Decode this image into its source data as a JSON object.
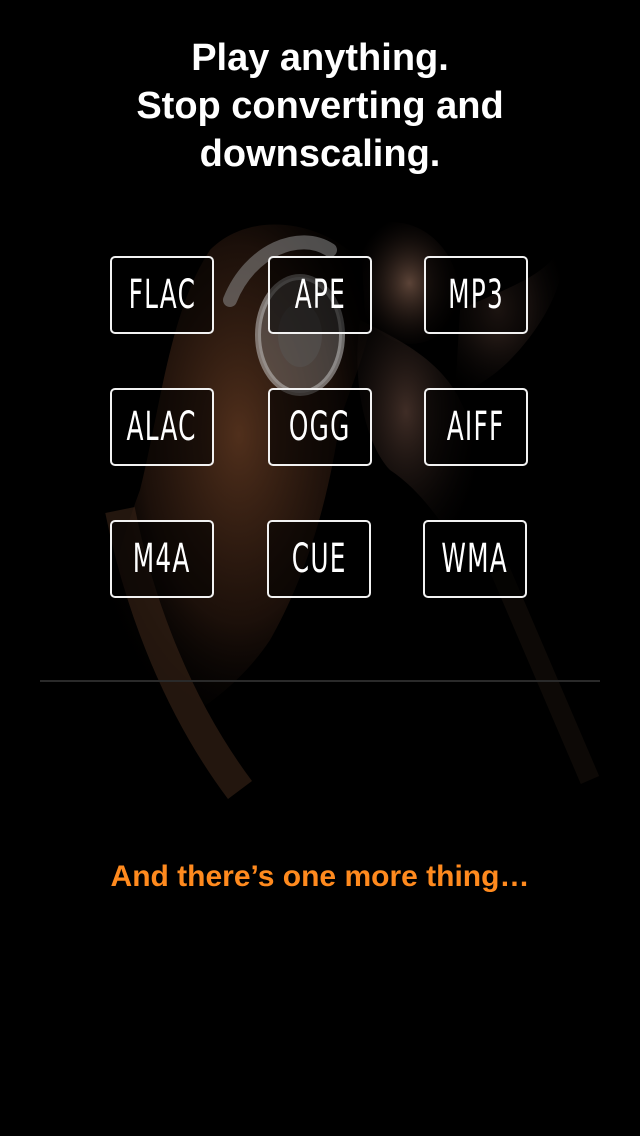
{
  "headline": {
    "line1": "Play anything.",
    "line2": "Stop converting and",
    "line3": "downscaling."
  },
  "formats": [
    {
      "label": "FLAC"
    },
    {
      "label": "APE"
    },
    {
      "label": "MP3"
    },
    {
      "label": "ALAC"
    },
    {
      "label": "OGG"
    },
    {
      "label": "AIFF"
    },
    {
      "label": "M4A"
    },
    {
      "label": "CUE"
    },
    {
      "label": "WMA"
    }
  ],
  "teaser": {
    "text": "And there’s one more thing…",
    "color": "#ff8a1e"
  },
  "colors": {
    "background": "#000000",
    "text": "#ffffff",
    "tile_border": "#f2f2f2"
  },
  "background_image": {
    "icon": "woman-with-headphones-illustration"
  }
}
